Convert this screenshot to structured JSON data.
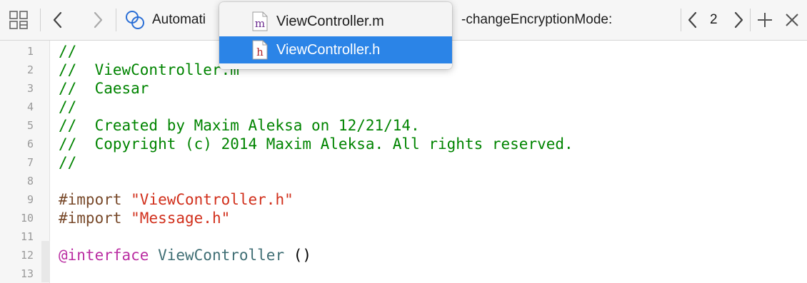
{
  "jumpbar": {
    "related_items_icon": "grid-related-items-icon",
    "back_icon": "chevron-left-icon",
    "forward_icon": "chevron-right-icon",
    "breadcrumb_icon": "automation-rings-icon",
    "breadcrumb_project": "Automati",
    "breadcrumb_method": "-changeEncryptionMode:",
    "prev_issue_icon": "chevron-left-icon",
    "issue_count": "2",
    "next_issue_icon": "chevron-right-icon",
    "add_icon": "plus-icon",
    "close_icon": "close-icon"
  },
  "popup": {
    "items": [
      {
        "label": "ViewController.m",
        "icon_letter": "m",
        "icon_color": "#6b2b8f",
        "selected": false
      },
      {
        "label": "ViewController.h",
        "icon_letter": "h",
        "icon_color": "#b0232a",
        "selected": true
      }
    ]
  },
  "editor": {
    "line_numbers": [
      "1",
      "2",
      "3",
      "4",
      "5",
      "6",
      "7",
      "8",
      "9",
      "10",
      "11",
      "12",
      "13"
    ],
    "lines": [
      {
        "parts": [
          {
            "type": "comment",
            "text": "//"
          }
        ]
      },
      {
        "parts": [
          {
            "type": "comment",
            "text": "//  ViewController.m"
          }
        ]
      },
      {
        "parts": [
          {
            "type": "comment",
            "text": "//  Caesar"
          }
        ]
      },
      {
        "parts": [
          {
            "type": "comment",
            "text": "//"
          }
        ]
      },
      {
        "parts": [
          {
            "type": "comment",
            "text": "//  Created by Maxim Aleksa on 12/21/14."
          }
        ]
      },
      {
        "parts": [
          {
            "type": "comment",
            "text": "//  Copyright (c) 2014 Maxim Aleksa. All rights reserved."
          }
        ]
      },
      {
        "parts": [
          {
            "type": "comment",
            "text": "//"
          }
        ]
      },
      {
        "parts": []
      },
      {
        "parts": [
          {
            "type": "directive",
            "text": "#import "
          },
          {
            "type": "string",
            "text": "\"ViewController.h\""
          }
        ]
      },
      {
        "parts": [
          {
            "type": "directive",
            "text": "#import "
          },
          {
            "type": "string",
            "text": "\"Message.h\""
          }
        ]
      },
      {
        "parts": []
      },
      {
        "parts": [
          {
            "type": "keyword",
            "text": "@interface"
          },
          {
            "type": "plain",
            "text": " "
          },
          {
            "type": "class",
            "text": "ViewController"
          },
          {
            "type": "plain",
            "text": " ()"
          }
        ]
      },
      {
        "parts": []
      }
    ]
  },
  "colors": {
    "comment": "#008400",
    "directive": "#78492a",
    "string": "#d12f1b",
    "keyword": "#ba2da2",
    "class": "#3f6e74",
    "selection": "#2b84e7"
  }
}
